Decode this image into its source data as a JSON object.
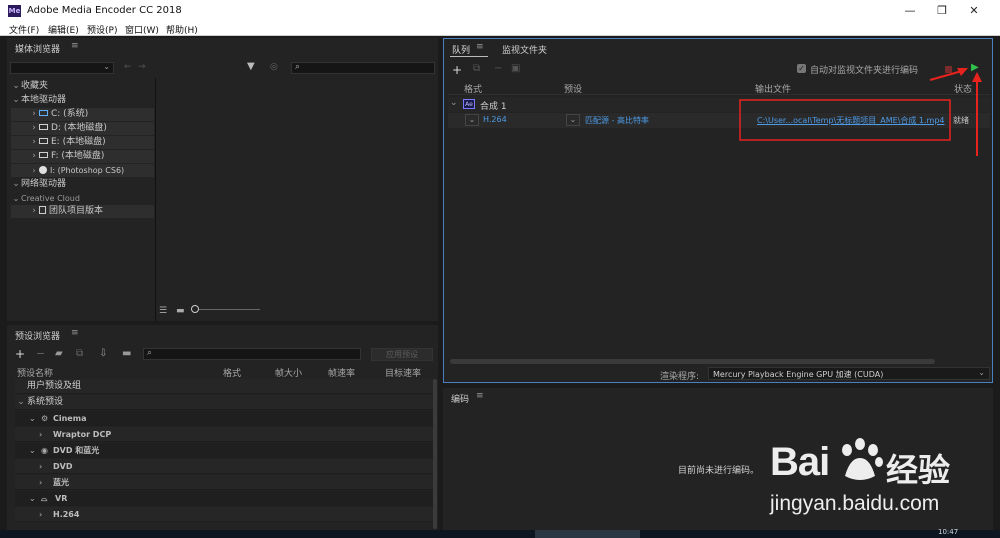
{
  "window": {
    "title": "Adobe Media Encoder CC 2018",
    "icon_text": "Me",
    "minimize": "—",
    "maximize": "❐",
    "close": "✕"
  },
  "menu": [
    "文件(F)",
    "编辑(E)",
    "预设(P)",
    "窗口(W)",
    "帮助(H)"
  ],
  "media_browser": {
    "title": "媒体浏览器",
    "search_icon_glyph": "⌕",
    "tree": [
      {
        "label": "收藏夹"
      },
      {
        "label": "本地驱动器"
      },
      {
        "label": "C: (系统)"
      },
      {
        "label": "D: (本地磁盘)"
      },
      {
        "label": "E: (本地磁盘)"
      },
      {
        "label": "F: (本地磁盘)"
      },
      {
        "label": "I: (Photoshop CS6)"
      },
      {
        "label": "网络驱动器"
      },
      {
        "label": "Creative Cloud"
      },
      {
        "label": "团队项目版本"
      }
    ]
  },
  "queue": {
    "tabs": [
      "队列",
      "监视文件夹"
    ],
    "auto_encode_label": "自动对监视文件夹进行编码",
    "columns": {
      "format": "格式",
      "preset": "预设",
      "output": "输出文件",
      "status": "状态"
    },
    "group": {
      "label": "合成 1",
      "badge": "Ae"
    },
    "row": {
      "format": "H.264",
      "preset": "匹配源 - 高比特率",
      "output": "C:\\User...ocal\\Temp\\无标题项目_AME\\合成 1.mp4",
      "status": "就绪"
    },
    "renderer_label": "渲染程序:",
    "renderer_value": "Mercury Playback Engine GPU 加速 (CUDA)"
  },
  "preset_browser": {
    "title": "预设浏览器",
    "apply_button": "应用预设",
    "columns": {
      "name": "预设名称",
      "format": "格式",
      "frame_size": "帧大小",
      "frame_rate": "帧速率",
      "target_rate": "目标速率"
    },
    "rows": [
      {
        "label": "用户预设及组"
      },
      {
        "label": "系统预设"
      },
      {
        "label": "Cinema"
      },
      {
        "label": "Wraptor DCP"
      },
      {
        "label": "DVD 和蓝光"
      },
      {
        "label": "DVD"
      },
      {
        "label": "蓝光"
      },
      {
        "label": "VR"
      },
      {
        "label": "H.264"
      }
    ]
  },
  "encoding": {
    "title": "编码",
    "empty_message": "目前尚未进行编码。"
  },
  "watermark": {
    "brand_left": "Bai",
    "brand_right": "经验",
    "url": "jingyan.baidu.com"
  },
  "taskbar_clock": "10:47",
  "colors": {
    "accent_blue": "#4d9be6",
    "annotation_red": "#e8231e",
    "play_green": "#2fc24a"
  }
}
